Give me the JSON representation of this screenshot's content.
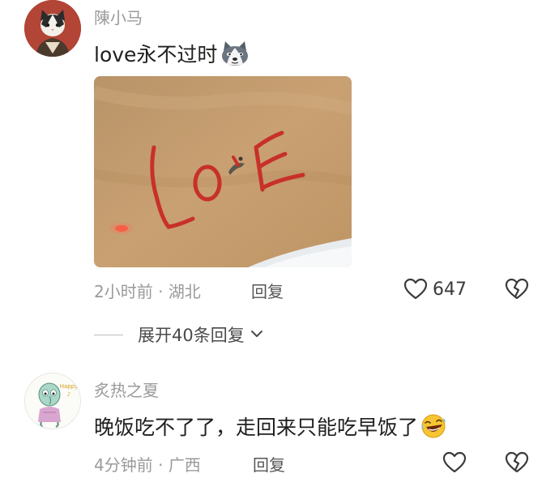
{
  "comments": [
    {
      "username": "陳小马",
      "text": "love永不过时",
      "emoji_icon": "husky-dog-emoji-icon",
      "image_text": "LoVE",
      "time": "2小时前",
      "separator": "·",
      "location": "湖北",
      "reply_label": "回复",
      "like_count": "647",
      "liked": false,
      "expand_label": "展开40条回复"
    },
    {
      "username": "炙热之夏",
      "text": "晚饭吃不了了，走回来只能吃早饭了",
      "emoji_icon": "rofl-emoji-icon",
      "avatar_badge": "Happy",
      "time": "4分钟前",
      "separator": "·",
      "location": "广西",
      "reply_label": "回复",
      "like_count": ""
    }
  ],
  "colors": {
    "meta_gray": "#9a9a9a",
    "text": "#1f1f1f",
    "love_red": "#c8302a"
  }
}
